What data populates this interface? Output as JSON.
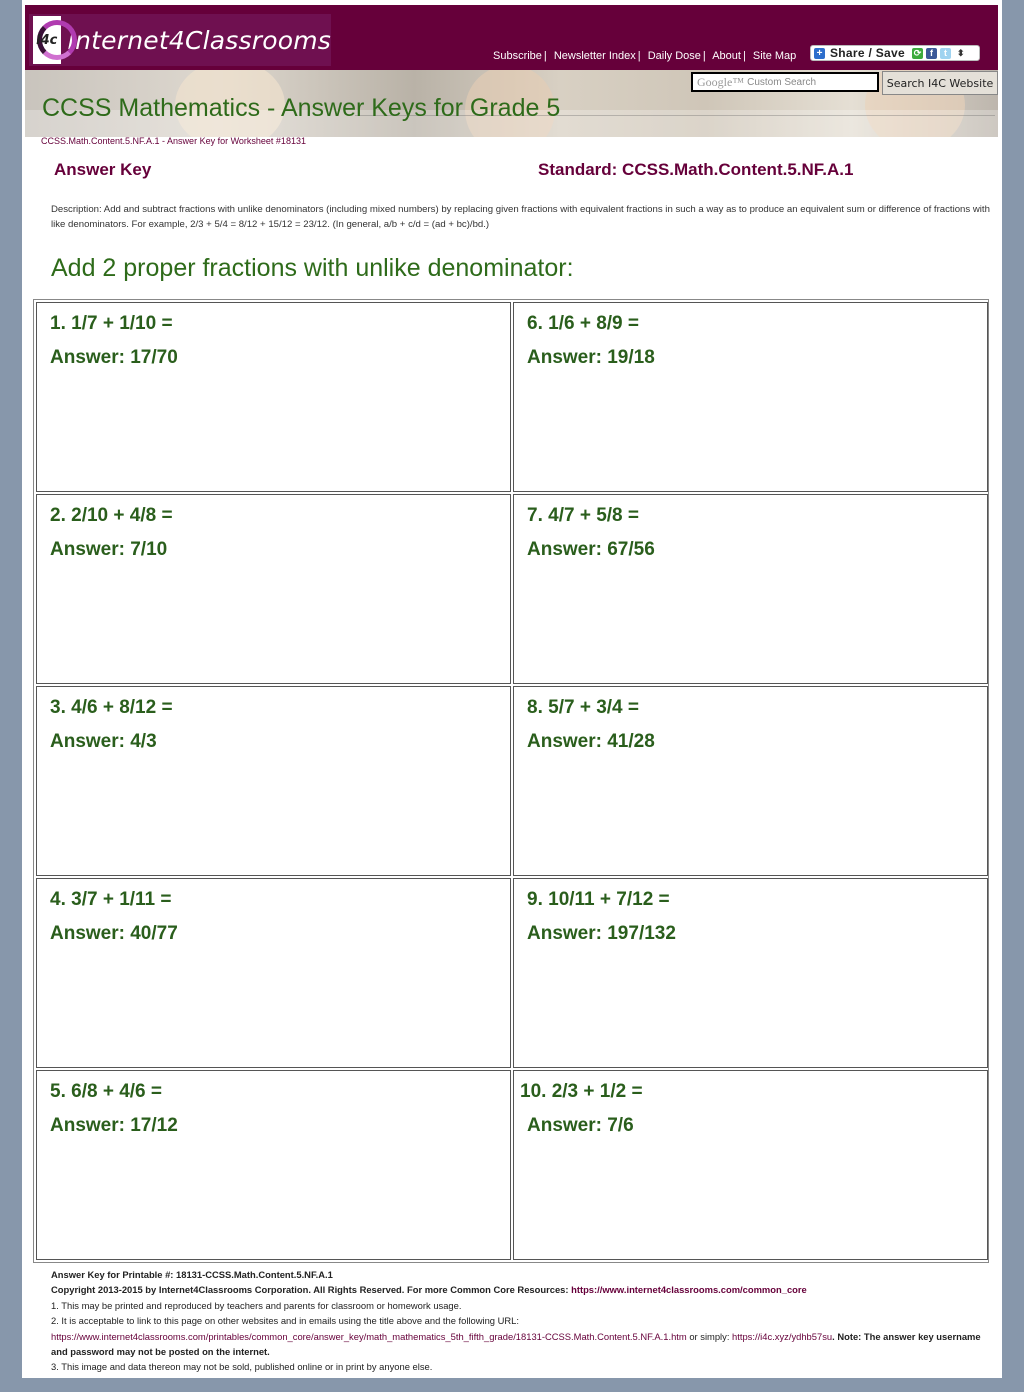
{
  "header": {
    "logo_badge": "i4c",
    "logo_text": "Internet4Classrooms",
    "nav": [
      "Subscribe",
      "Newsletter Index",
      "Daily Dose",
      "About",
      "Site Map"
    ],
    "share_label": "Share / Save",
    "share_icons": [
      "share-plus-icon",
      "email-share-icon",
      "facebook-icon",
      "twitter-icon",
      "expand-arrows-icon"
    ]
  },
  "banner": {
    "title": "CCSS Mathematics - Answer Keys for Grade 5",
    "search_brand": "Google™",
    "search_placeholder": "Custom Search",
    "search_button": "Search I4C Website"
  },
  "breadcrumb": "CCSS.Math.Content.5.NF.A.1 - Answer Key for Worksheet #18131",
  "answer_key": {
    "title": "Answer Key",
    "standard": "Standard: CCSS.Math.Content.5.NF.A.1",
    "description": "Description: Add and subtract fractions with unlike denominators (including mixed numbers) by replacing given fractions with equivalent fractions in such a way as to produce an equivalent sum or difference of fractions with like denominators. For example, 2/3 + 5/4 = 8/12 + 15/12 = 23/12. (In general, a/b + c/d = (ad + bc)/bd.)"
  },
  "section_heading": "Add 2 proper fractions with unlike denominator:",
  "problems": [
    {
      "question": "1. 1/7 + 1/10 =",
      "answer": "Answer: 17/70"
    },
    {
      "question": "6. 1/6 + 8/9 =",
      "answer": "Answer: 19/18"
    },
    {
      "question": "2. 2/10 + 4/8 =",
      "answer": "Answer: 7/10"
    },
    {
      "question": "7. 4/7 + 5/8 =",
      "answer": "Answer: 67/56"
    },
    {
      "question": "3. 4/6 + 8/12 =",
      "answer": "Answer: 4/3"
    },
    {
      "question": "8. 5/7 + 3/4 =",
      "answer": "Answer: 41/28"
    },
    {
      "question": "4. 3/7 + 1/11 =",
      "answer": "Answer: 40/77"
    },
    {
      "question": "9. 10/11 + 7/12 =",
      "answer": "Answer: 197/132"
    },
    {
      "question": "5. 6/8 + 4/6 =",
      "answer": "Answer: 17/12"
    },
    {
      "question": "10. 2/3 + 1/2 =",
      "answer": "Answer: 7/6"
    }
  ],
  "footer": {
    "printable": "Answer Key for Printable #: 18131-CCSS.Math.Content.5.NF.A.1",
    "copyright": "Copyright 2013-2015 by Internet4Classrooms Corporation. All Rights Reserved. For more Common Core Resources: ",
    "copyright_link": "https://www.internet4classrooms.com/common_core",
    "note1": "1. This may be printed and reproduced by teachers and parents for classroom or homework usage.",
    "note2": "2. It is acceptable to link to this page on other websites and in emails using the title above and the following URL:",
    "url_long": "https://www.internet4classrooms.com/printables/common_core/answer_key/math_mathematics_5th_fifth_grade/18131-CCSS.Math.Content.5.NF.A.1.htm",
    "or_simply": " or simply: ",
    "url_short": "https://i4c.xyz/ydhb57su",
    "note_bold": ". Note: The answer key username and password may not be posted on the internet.",
    "note3": "3. This image and data thereon may not be sold, published online or in print by anyone else."
  }
}
